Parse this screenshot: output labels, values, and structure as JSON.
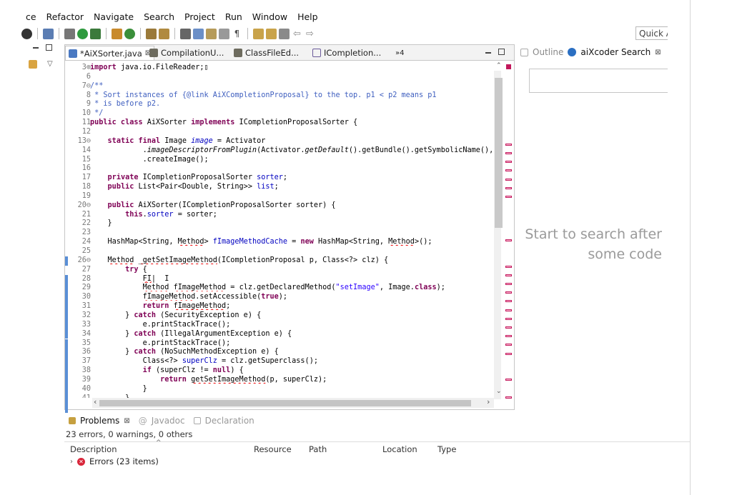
{
  "menu": [
    "ce",
    "Refactor",
    "Navigate",
    "Search",
    "Project",
    "Run",
    "Window",
    "Help"
  ],
  "quick_access": "Quick A",
  "tabs": [
    {
      "label": "*AiXSorter.java",
      "close": "⊠"
    },
    {
      "label": "CompilationU..."
    },
    {
      "label": "ClassFileEd..."
    },
    {
      "label": "ICompletion..."
    },
    {
      "label": "»4"
    }
  ],
  "side_tabs": {
    "outline": "Outline",
    "search": "aiXcoder Search"
  },
  "side_message": "Start to search after some code",
  "code": [
    {
      "n": "3⊕",
      "html": "<span class='kw'>import</span> java.io.FileReader;▯"
    },
    {
      "n": "6",
      "html": ""
    },
    {
      "n": "7⊖",
      "html": "<span class='cm'>/**</span>"
    },
    {
      "n": "8",
      "html": "<span class='cm'> * Sort instances of {@link AiXCompletionProposal} to the top. p1 &lt; p2 means p1</span>"
    },
    {
      "n": "9",
      "html": "<span class='cm'> * is before p2.</span>"
    },
    {
      "n": "10",
      "html": "<span class='cm'> */</span>"
    },
    {
      "n": "11",
      "html": "<span class='kw'>public class</span> AiXSorter <span class='kw'>implements</span> ICompletionProposalSorter {"
    },
    {
      "n": "12",
      "html": ""
    },
    {
      "n": "13⊖",
      "html": "    <span class='kw'>static final</span> Image <span class='fd it'>image</span> = Activator"
    },
    {
      "n": "14",
      "html": "            .<span class='it'>imageDescriptorFromPlugin</span>(Activator.<span class='it'>getDefault</span>().getBundle().getSymbolicName(), \""
    },
    {
      "n": "15",
      "html": "            .createImage();"
    },
    {
      "n": "16",
      "html": ""
    },
    {
      "n": "17",
      "html": "    <span class='kw'>private</span> ICompletionProposalSorter <span class='fd'>sorter</span>;"
    },
    {
      "n": "18",
      "html": "    <span class='kw'>public</span> List&lt;Pair&lt;Double, String&gt;&gt; <span class='fd'>list</span>;"
    },
    {
      "n": "19",
      "html": ""
    },
    {
      "n": "20⊖",
      "html": "    <span class='kw'>public</span> AiXSorter(ICompletionProposalSorter sorter) {"
    },
    {
      "n": "21",
      "html": "        <span class='kw'>this</span>.<span class='fd'>sorter</span> = sorter;"
    },
    {
      "n": "22",
      "html": "    }"
    },
    {
      "n": "23",
      "html": ""
    },
    {
      "n": "24",
      "html": "    HashMap&lt;String, <span class='err'>Method</span>&gt; <span class='fd'>fImageMethodCache</span> = <span class='kw'>new</span> HashMap&lt;String, <span class='err'>Method</span>&gt;();"
    },
    {
      "n": "25",
      "html": ""
    },
    {
      "n": "26⊖",
      "html": "    <span class='err'>Method</span> <span class='err'>_getSetImageMethod</span>(ICompletionProposal p, Class&lt;?&gt; clz) {"
    },
    {
      "n": "27",
      "html": "        <span class='kw'>try</span> {"
    },
    {
      "n": "28",
      "html": "            <span class='err'>FI</span>|  I"
    },
    {
      "n": "29",
      "html": "            <span class='err'>Method</span> <span class='err'>fImageMethod</span> = clz.getDeclaredMethod(<span class='str'>\"setImage\"</span>, Image.<span class='kw'>class</span>);"
    },
    {
      "n": "30",
      "html": "            <span class='err'>fImageMethod</span>.setAccessible(<span class='kw'>true</span>);"
    },
    {
      "n": "31",
      "html": "            <span class='kw'>return</span> <span class='err'>fImageMethod</span>;"
    },
    {
      "n": "32",
      "html": "        } <span class='kw'>catch</span> (SecurityException e) {"
    },
    {
      "n": "33",
      "html": "            e.printStackTrace();"
    },
    {
      "n": "34",
      "html": "        } <span class='kw'>catch</span> (IllegalArgumentException e) {"
    },
    {
      "n": "35",
      "html": "            e.printStackTrace();"
    },
    {
      "n": "36",
      "html": "        } <span class='kw'>catch</span> (NoSuchMethodException e) {"
    },
    {
      "n": "37",
      "html": "            Class&lt;?&gt; <span class='fd'>superClz</span> = clz.getSuperclass();"
    },
    {
      "n": "38",
      "html": "            <span class='kw'>if</span> (superClz != <span class='kw'>null</span>) {"
    },
    {
      "n": "39",
      "html": "                <span class='kw'>return</span> <span class='err'>getSetImageMethod</span>(p, superClz);"
    },
    {
      "n": "40",
      "html": "            }"
    },
    {
      "n": "41",
      "html": "        }"
    }
  ],
  "markers_rows": [
    9,
    10,
    11,
    12,
    13,
    14,
    15,
    20,
    23,
    24,
    25,
    26,
    27,
    28,
    29,
    30,
    31,
    32,
    33,
    36,
    38
  ],
  "gutter_rows": [
    21,
    23,
    24,
    25,
    26,
    27,
    28,
    29,
    30,
    31,
    32,
    33,
    34,
    35,
    36,
    37,
    38,
    39,
    40
  ],
  "bottom": {
    "tab_problems": "Problems",
    "tab_javadoc": "Javadoc",
    "tab_declaration": "Declaration",
    "summary": "23 errors, 0 warnings, 0 others",
    "col_description": "Description",
    "col_resource": "Resource",
    "col_path": "Path",
    "col_location": "Location",
    "col_type": "Type",
    "errors_row": "Errors (23 items)"
  },
  "colors": {
    "keyword": "#7f0055",
    "comment": "#3f5fbf",
    "field": "#0000c0",
    "string": "#2a00ff",
    "error": "#d9263a"
  }
}
